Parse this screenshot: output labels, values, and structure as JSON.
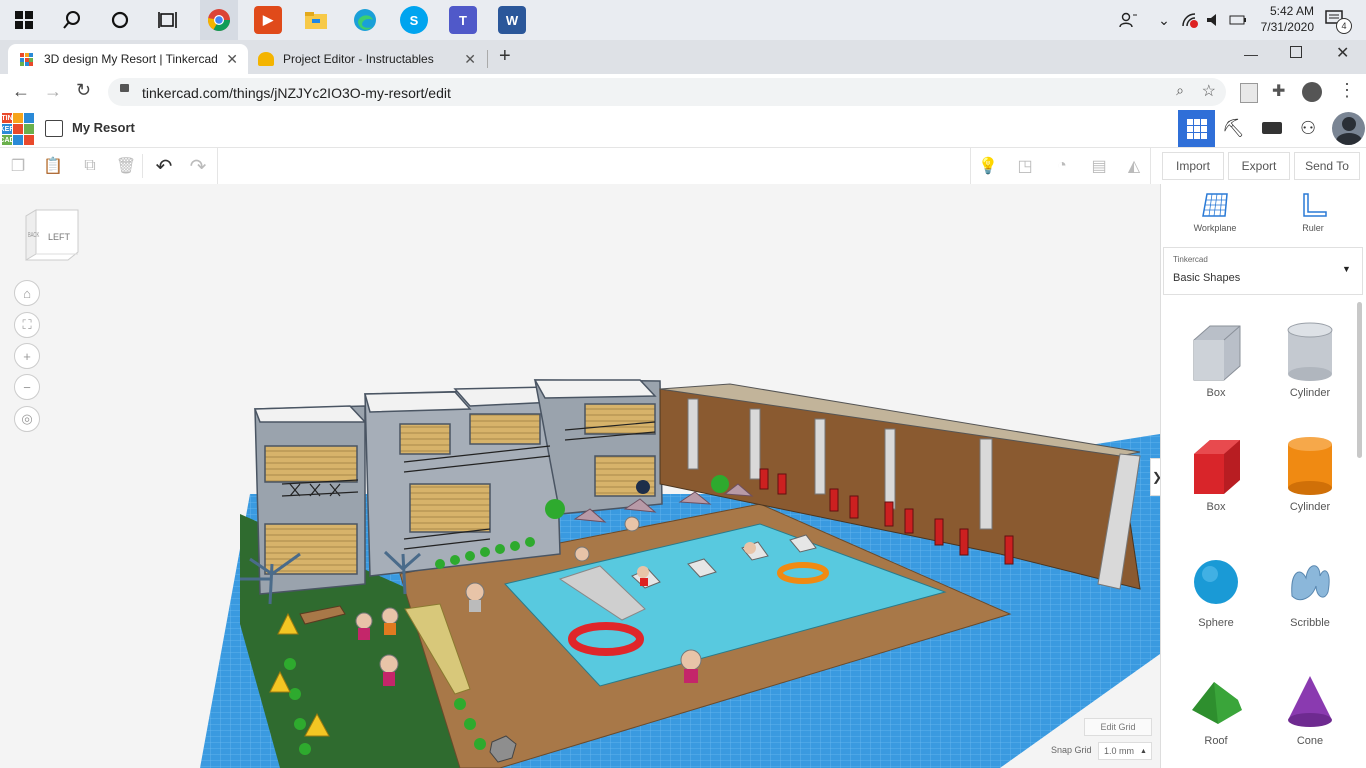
{
  "taskbar": {
    "clock_time": "5:42 AM",
    "clock_date": "7/31/2020",
    "notification_count": "4"
  },
  "browser": {
    "tabs": [
      {
        "title": "3D design My Resort | Tinkercad"
      },
      {
        "title": "Project Editor - Instructables"
      }
    ],
    "new_tab_label": "+",
    "url": "tinkercad.com/things/jNZJYc2IO3O-my-resort/edit"
  },
  "app": {
    "logo_letters": [
      "TIN",
      "KER",
      "CAD"
    ],
    "design_title": "My Resort"
  },
  "toolbar": {
    "import_label": "Import",
    "export_label": "Export",
    "send_to_label": "Send To"
  },
  "viewcube": {
    "face_front": "LEFT",
    "face_side": "BACK"
  },
  "panel": {
    "workplane_label": "Workplane",
    "ruler_label": "Ruler",
    "library_source": "Tinkercad",
    "library_selected": "Basic Shapes",
    "shapes": [
      {
        "label": "Box",
        "color": "#b9bfc8"
      },
      {
        "label": "Cylinder",
        "color": "#c4c9d0"
      },
      {
        "label": "Box",
        "color": "#d9252a"
      },
      {
        "label": "Cylinder",
        "color": "#f08a12"
      },
      {
        "label": "Sphere",
        "color": "#1a9ad6"
      },
      {
        "label": "Scribble",
        "color": "#8bb7da"
      },
      {
        "label": "Roof",
        "color": "#3aa53a"
      },
      {
        "label": "Cone",
        "color": "#8a3ab0"
      }
    ]
  },
  "viewport": {
    "edit_grid_label": "Edit Grid",
    "snap_grid_label": "Snap Grid",
    "snap_grid_value": "1.0 mm"
  },
  "colors": {
    "pool": "#58c9df",
    "deck": "#a87848",
    "grass": "#2f6b2f",
    "workplane_grid": "#3a9ae0",
    "accent": "#2f6fd8"
  }
}
